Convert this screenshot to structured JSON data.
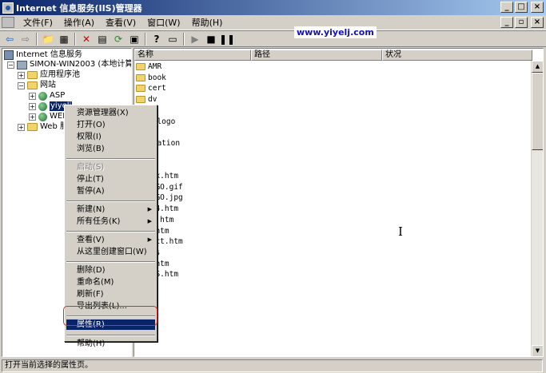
{
  "window": {
    "title": "Internet 信息服务(IIS)管理器",
    "controls": [
      "_",
      "□",
      "×"
    ]
  },
  "menubar": {
    "items": [
      "文件(F)",
      "操作(A)",
      "查看(V)",
      "窗口(W)",
      "帮助(H)"
    ],
    "mdi_controls": [
      "_",
      "▫",
      "×"
    ]
  },
  "watermark": "www.yiyelj.com",
  "tree": {
    "root": "Internet 信息服务",
    "computer": "SIMON-WIN2003 (本地计算机)",
    "app_pools": "应用程序池",
    "websites": "网站",
    "site_asp": "ASP",
    "site_selected": "yiyelj",
    "site_web": "WEB",
    "web_ext": "Web 服"
  },
  "list": {
    "columns": [
      "名称",
      "路径",
      "状况"
    ],
    "rows": [
      {
        "name": "AMR",
        "type": "folder"
      },
      {
        "name": "book",
        "type": "folder"
      },
      {
        "name": "cert",
        "type": "folder"
      },
      {
        "name": "dv",
        "type": "folder"
      },
      {
        "name": "T",
        "type": "folder"
      },
      {
        "name": "k-logo",
        "type": "folder"
      },
      {
        "name": "n",
        "type": "folder"
      },
      {
        "name": "ulation",
        "type": "folder"
      },
      {
        "name": "e",
        "type": "folder"
      },
      {
        "name": "e",
        "type": "file"
      },
      {
        "name": "dex.htm",
        "type": "file"
      },
      {
        "name": "LOGO.gif",
        "type": "file"
      },
      {
        "name": "LOGO.jpg",
        "type": "file"
      },
      {
        "name": "A.4.htm",
        "type": "file"
      },
      {
        "name": "dq.htm",
        "type": "file"
      },
      {
        "name": "s.htm",
        "type": "file"
      },
      {
        "name": "tact.htm",
        "type": "file"
      },
      {
        "name": "css",
        "type": "file"
      },
      {
        "name": "P.htm",
        "type": "file"
      },
      {
        "name": "DOS.htm",
        "type": "file"
      }
    ]
  },
  "context_menu": {
    "items": [
      {
        "label": "资源管理器(X)",
        "disabled": false
      },
      {
        "label": "打开(O)",
        "disabled": false
      },
      {
        "label": "权限(I)",
        "disabled": false
      },
      {
        "label": "浏览(B)",
        "disabled": false
      },
      {
        "label": "启动(S)",
        "disabled": true
      },
      {
        "label": "停止(T)",
        "disabled": false
      },
      {
        "label": "暂停(A)",
        "disabled": false
      },
      {
        "label": "新建(N)",
        "disabled": false,
        "submenu": true
      },
      {
        "label": "所有任务(K)",
        "disabled": false,
        "submenu": true
      },
      {
        "label": "查看(V)",
        "disabled": false,
        "submenu": true
      },
      {
        "label": "从这里创建窗口(W)",
        "disabled": false
      },
      {
        "label": "删除(D)",
        "disabled": false
      },
      {
        "label": "重命名(M)",
        "disabled": false
      },
      {
        "label": "刷新(F)",
        "disabled": false
      },
      {
        "label": "导出列表(L)...",
        "disabled": false
      },
      {
        "label": "属性(R)",
        "disabled": false,
        "highlighted": true
      },
      {
        "label": "帮助(H)",
        "disabled": false
      }
    ]
  },
  "statusbar": {
    "text": "打开当前选择的属性页。"
  },
  "colors": {
    "title_start": "#0a246a",
    "title_end": "#a6caf0",
    "highlight": "#0a246a",
    "callout_border": "#d03030",
    "watermark": "#1010c0"
  }
}
